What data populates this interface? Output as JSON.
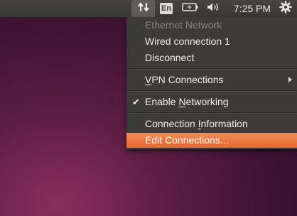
{
  "panel": {
    "network_icon": "network-updown-icon",
    "language": "En",
    "battery_icon": "battery-icon",
    "sound_icon": "speaker-volume-icon",
    "clock": "7:25 PM",
    "settings_icon": "gear-icon"
  },
  "menu": {
    "header": "Ethernet Network",
    "wired_connection": "Wired connection 1",
    "disconnect": "Disconnect",
    "vpn": {
      "mnemonic": "V",
      "rest": "PN Connections"
    },
    "enable_networking": {
      "before": "Enable ",
      "mnemonic": "N",
      "after": "etworking",
      "checked": true
    },
    "connection_info": {
      "before": "Connection ",
      "mnemonic": "I",
      "after": "nformation"
    },
    "edit_connections": "Edit Connections..."
  },
  "colors": {
    "highlight": "#e6682f",
    "panel": "#3c3b37",
    "disabled_text": "#87857f"
  }
}
